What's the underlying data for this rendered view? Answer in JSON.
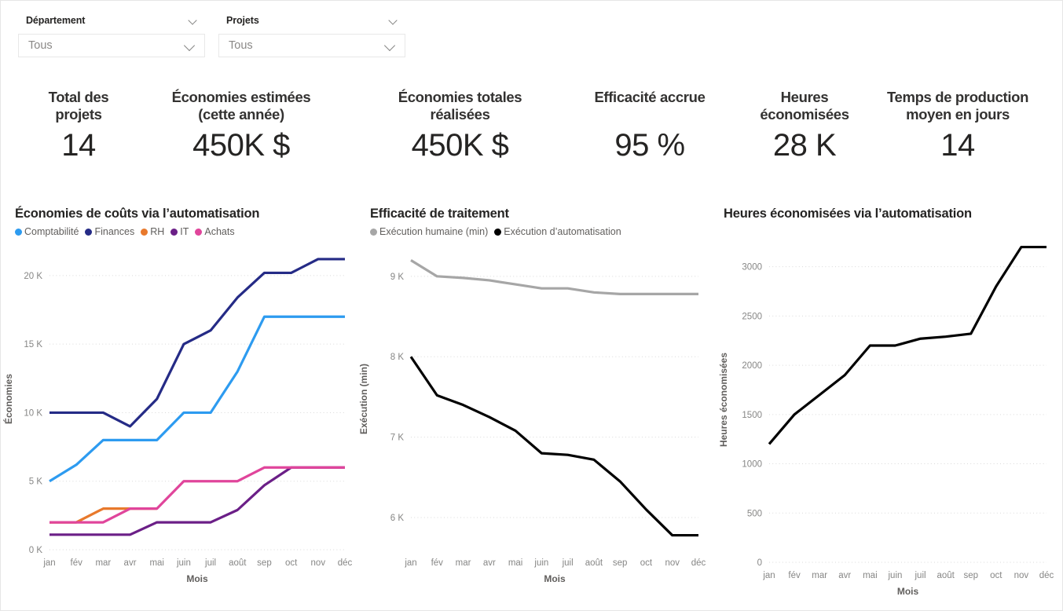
{
  "filters": [
    {
      "title": "Département",
      "value": "Tous",
      "icon": "chevron-down-icon",
      "name": "departement"
    },
    {
      "title": "Projets",
      "value": "Tous",
      "icon": "chevron-down-icon",
      "name": "projets"
    }
  ],
  "kpis": [
    {
      "label": "Total des projets",
      "value": "14",
      "name": "total-des-projets"
    },
    {
      "label": "Économies estimées (cette année)",
      "value": "450K $",
      "name": "economies-estimees"
    },
    {
      "label": "Économies totales réalisées",
      "value": "450K $",
      "name": "economies-totales-realisees"
    },
    {
      "label": "Efficacité accrue",
      "value": "95 %",
      "name": "efficacite-accrue"
    },
    {
      "label": "Heures économisées",
      "value": "28 K",
      "name": "heures-economisees"
    },
    {
      "label": "Temps de production moyen en jours",
      "value": "14",
      "name": "temps-de-production-moyen"
    }
  ],
  "kpi_labels_lines": [
    [
      "Total des",
      "projets"
    ],
    [
      "Économies estimées",
      "(cette année)"
    ],
    [
      "Économies totales",
      "réalisées"
    ],
    [
      "Efficacité accrue"
    ],
    [
      "Heures",
      "économisées"
    ],
    [
      "Temps de production",
      "moyen en jours"
    ]
  ],
  "chart_data": [
    {
      "type": "line",
      "name": "economies-de-couts",
      "title": "Économies de coûts via l’automatisation",
      "xlabel": "Mois",
      "ylabel": "Économies",
      "categories": [
        "jan",
        "fév",
        "mar",
        "avr",
        "mai",
        "juin",
        "juil",
        "août",
        "sep",
        "oct",
        "nov",
        "déc"
      ],
      "ylim": [
        0,
        22000
      ],
      "yticks": [
        0,
        5000,
        10000,
        15000,
        20000
      ],
      "yticklabels": [
        "0 K",
        "5 K",
        "10 K",
        "15 K",
        "20 K"
      ],
      "grid": true,
      "legend_position": "top",
      "series": [
        {
          "name": "Comptabilité",
          "color": "#2d9bf0",
          "values": [
            5000,
            6200,
            8000,
            8000,
            8000,
            10000,
            10000,
            13000,
            17000,
            17000,
            17000,
            17000
          ]
        },
        {
          "name": "Finances",
          "color": "#252b86",
          "values": [
            10000,
            10000,
            10000,
            9000,
            11000,
            15000,
            16000,
            18400,
            20200,
            20200,
            21200,
            21200
          ]
        },
        {
          "name": "RH",
          "color": "#e8792c",
          "values": [
            2000,
            2000,
            3000,
            3000,
            3000,
            null,
            null,
            null,
            null,
            null,
            null,
            null
          ]
        },
        {
          "name": "IT",
          "color": "#6b1f87",
          "values": [
            1100,
            1100,
            1100,
            1100,
            2000,
            2000,
            2000,
            2900,
            4700,
            6000,
            6000,
            6000
          ]
        },
        {
          "name": "Achats",
          "color": "#e0459b",
          "values": [
            2000,
            2000,
            2000,
            3000,
            3000,
            5000,
            5000,
            5000,
            6000,
            6000,
            6000,
            6000
          ]
        }
      ]
    },
    {
      "type": "line",
      "name": "efficacite-de-traitement",
      "title": "Efficacité de traitement",
      "xlabel": "Mois",
      "ylabel": "Exécution (min)",
      "categories": [
        "jan",
        "fév",
        "mar",
        "avr",
        "mai",
        "juin",
        "juil",
        "août",
        "sep",
        "oct",
        "nov",
        "déc"
      ],
      "ylim": [
        5600,
        9350
      ],
      "yticks": [
        6000,
        7000,
        8000,
        9000
      ],
      "yticklabels": [
        "6 K",
        "7 K",
        "8 K",
        "9 K"
      ],
      "grid": true,
      "legend_position": "top",
      "series": [
        {
          "name": "Exécution humaine (min)",
          "color": "#a6a6a6",
          "values": [
            9200,
            9000,
            8980,
            8950,
            8900,
            8850,
            8850,
            8800,
            8780,
            8780,
            8780,
            8780
          ]
        },
        {
          "name": "Exécution d’automatisation",
          "color": "#000000",
          "values": [
            8000,
            7520,
            7400,
            7250,
            7080,
            6800,
            6780,
            6720,
            6450,
            6100,
            5780,
            5780
          ]
        }
      ]
    },
    {
      "type": "line",
      "name": "heures-economisees-via-automatisation",
      "title": "Heures économisées via l’automatisation",
      "xlabel": "Mois",
      "ylabel": "Heures économisées",
      "categories": [
        "jan",
        "fév",
        "mar",
        "avr",
        "mai",
        "juin",
        "juil",
        "août",
        "sep",
        "oct",
        "nov",
        "déc"
      ],
      "ylim": [
        0,
        3300
      ],
      "yticks": [
        0,
        500,
        1000,
        1500,
        2000,
        2500,
        3000
      ],
      "yticklabels": [
        "0",
        "500",
        "1000",
        "1500",
        "2000",
        "2500",
        "3000"
      ],
      "grid": true,
      "legend_position": "none",
      "series": [
        {
          "name": "Heures économisées",
          "color": "#000000",
          "values": [
            1200,
            1500,
            1700,
            1900,
            2200,
            2200,
            2270,
            2290,
            2320,
            2800,
            3200,
            3200
          ]
        }
      ]
    }
  ]
}
